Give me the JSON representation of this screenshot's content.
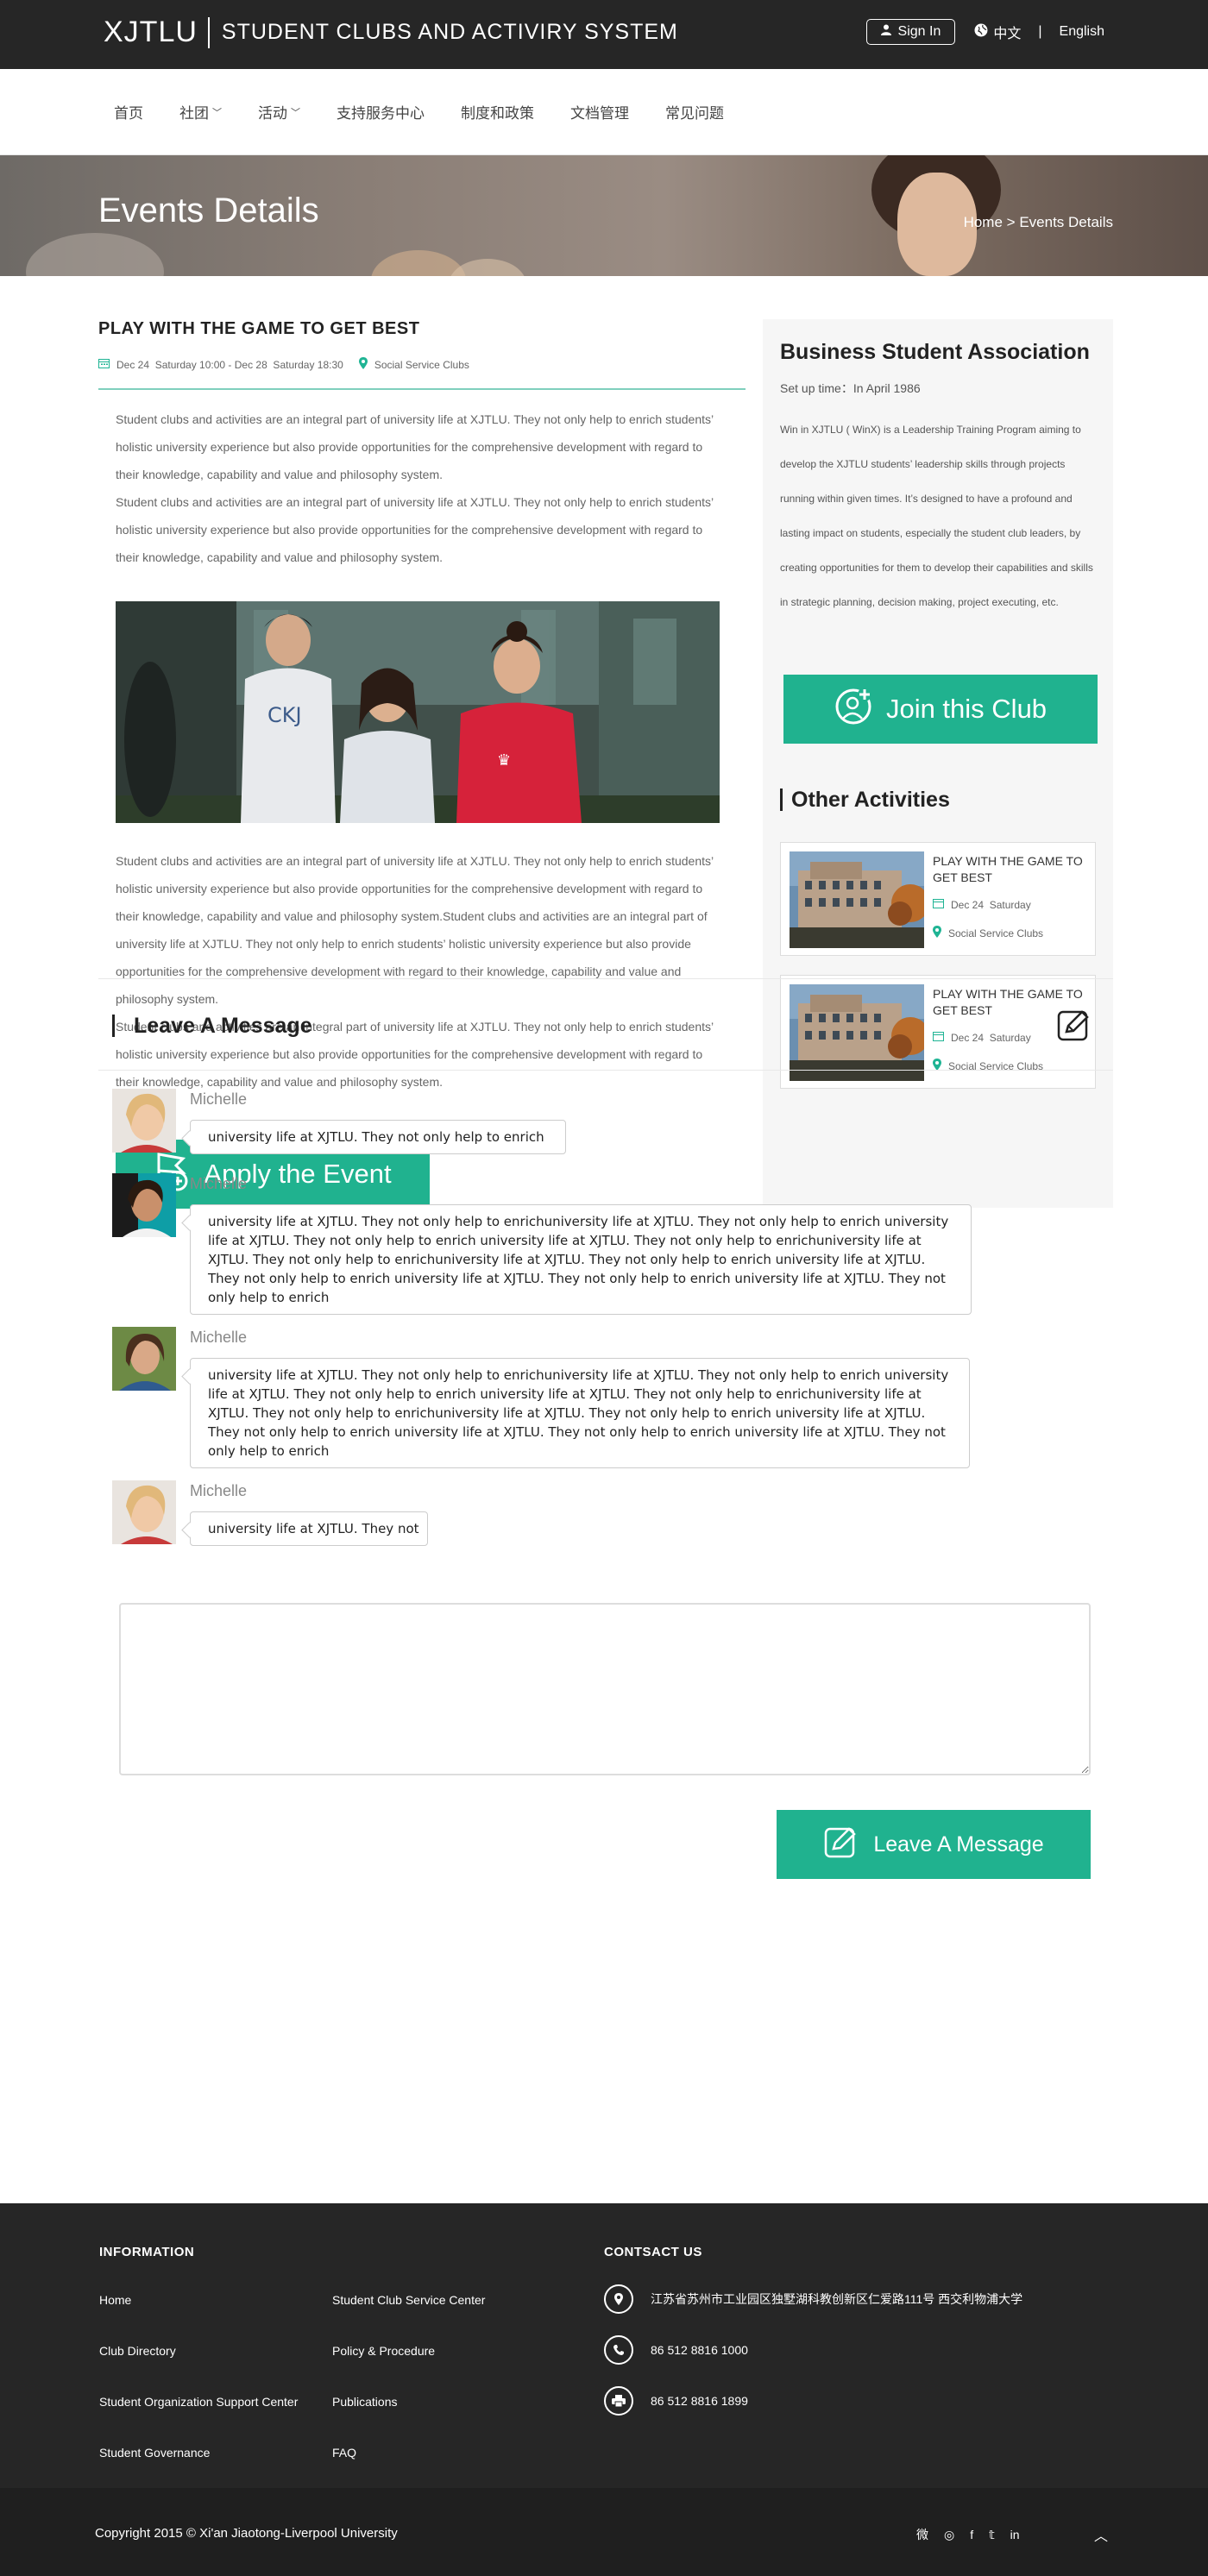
{
  "header": {
    "logo": "XJTLU",
    "system_name": "STUDENT CLUBS AND ACTIVIRY SYSTEM",
    "signin": "Sign In",
    "lang_cn": "中文",
    "lang_sep": "|",
    "lang_en": "English"
  },
  "nav": {
    "items": [
      {
        "label": "首页",
        "has_dropdown": false
      },
      {
        "label": "社团",
        "has_dropdown": true
      },
      {
        "label": "活动",
        "has_dropdown": true
      },
      {
        "label": "支持服务中心",
        "has_dropdown": false
      },
      {
        "label": "制度和政策",
        "has_dropdown": false
      },
      {
        "label": "文档管理",
        "has_dropdown": false
      },
      {
        "label": "常见问题",
        "has_dropdown": false
      }
    ],
    "dropdown_glyph": "﹀"
  },
  "hero": {
    "title": "Events Details",
    "breadcrumb_home": "Home",
    "breadcrumb_sep": ">",
    "breadcrumb_current": "Events Details"
  },
  "event": {
    "title": "PLAY WITH THE GAME TO GET BEST",
    "date": "Dec 24  Saturday 10:00 - Dec 28  Saturday 18:30",
    "club": "Social Service Clubs",
    "paragraph1": "Student clubs and activities are an integral part of university life at XJTLU. They not only help to enrich students’   holistic university experience but also provide opportunities for the comprehensive development with regard to their knowledge, capability and value and philosophy system.\nStudent clubs and activities are an integral part of university life at XJTLU. They not only help to enrich students’   holistic university experience but also provide opportunities for the comprehensive development with regard to their knowledge, capability and value and philosophy system.",
    "paragraph2": "Student clubs and activities are an integral part of university life at XJTLU. They not only help to enrich students’   holistic university experience but also provide opportunities for the comprehensive development with regard to their knowledge, capability and value and philosophy system.Student clubs and activities are an integral part of university life at XJTLU. They not only help to enrich students’ holistic university experience but also provide opportunities for the comprehensive development with regard to their knowledge, capability and value and philosophy system.\nStudent clubs and activities are an integral part of university life at XJTLU. They not only help to enrich students’   holistic university experience but also provide opportunities for the comprehensive development with regard to their knowledge, capability and value and philosophy system.",
    "apply_label": "Apply the Event"
  },
  "sidebar": {
    "club_name": "Business Student Association",
    "setup_time": "Set up time：In April 1986",
    "description": "Win in XJTLU ( WinX) is a Leadership Training Program aiming to develop the XJTLU students’   leadership skills through projects running within given times. It’s designed to have a profound and lasting impact on students, especially the student club leaders, by creating opportunities for them to develop their capabilities and skills in strategic planning, decision making, project executing, etc.",
    "join_label": "Join this Club",
    "other_title": "Other Activities",
    "activities": [
      {
        "title": "PLAY WITH THE GAME TO GET BEST",
        "date": "Dec 24  Saturday",
        "club": "Social Service Clubs"
      },
      {
        "title": "PLAY WITH THE GAME TO GET BEST",
        "date": "Dec 24  Saturday",
        "club": "Social Service Clubs"
      }
    ]
  },
  "messages": {
    "heading": "Leave A Message",
    "items": [
      {
        "name": "Michelle",
        "text": "university life at XJTLU. They not only help to enrich"
      },
      {
        "name": "Michelle",
        "text": "university life at XJTLU. They not only help to enrichuniversity life at XJTLU. They not only help to enrich university life at XJTLU. They not only help to enrich university life at XJTLU. They not only help to enrichuniversity life at XJTLU. They not only help to enrichuniversity life at XJTLU. They not only help to enrich university life at XJTLU. They not only help to enrich university life at XJTLU. They not only help to enrich university life at XJTLU. They not only help to enrich"
      },
      {
        "name": "Michelle",
        "text": "university life at XJTLU. They not only help to enrichuniversity life at XJTLU. They not only help to enrich university life at XJTLU. They not only help to enrich university life at XJTLU. They not only help to enrichuniversity life at XJTLU. They not only help to enrichuniversity life at XJTLU. They not only help to enrich university life at XJTLU. They not only help to enrich university life at XJTLU. They not only help to enrich university life at XJTLU. They not only help to enrich"
      },
      {
        "name": "Michelle",
        "text": "university life at XJTLU. They not"
      }
    ],
    "input_value": "",
    "send_label": "Leave A Message"
  },
  "footer": {
    "info_heading": "INFORMATION",
    "links_col1": [
      "Home",
      "Club Directory",
      "Student Organization Support Center",
      "Student Governance"
    ],
    "links_col2": [
      "Student Club Service Center",
      "Policy & Procedure",
      "Publications",
      "FAQ"
    ],
    "contact_heading": "CONTSACT US",
    "address": "江苏省苏州市工业园区独墅湖科教创新区仁爱路111号 西交利物浦大学",
    "phone": "86 512 8816 1000",
    "fax": "86 512 8816 1899",
    "copyright": "Copyright 2015 © Xi'an Jiaotong-Liverpool University",
    "social_icons": [
      "weibo-icon",
      "wechat-icon",
      "facebook-icon",
      "twitter-icon",
      "linkedin-icon"
    ],
    "social_glyphs": [
      "微",
      "◎",
      "f",
      "𝕥",
      "in"
    ],
    "top_glyph": "︿"
  },
  "colors": {
    "accent": "#20b28f",
    "dark": "#262626",
    "footer_bottom": "#1f1f1f"
  }
}
